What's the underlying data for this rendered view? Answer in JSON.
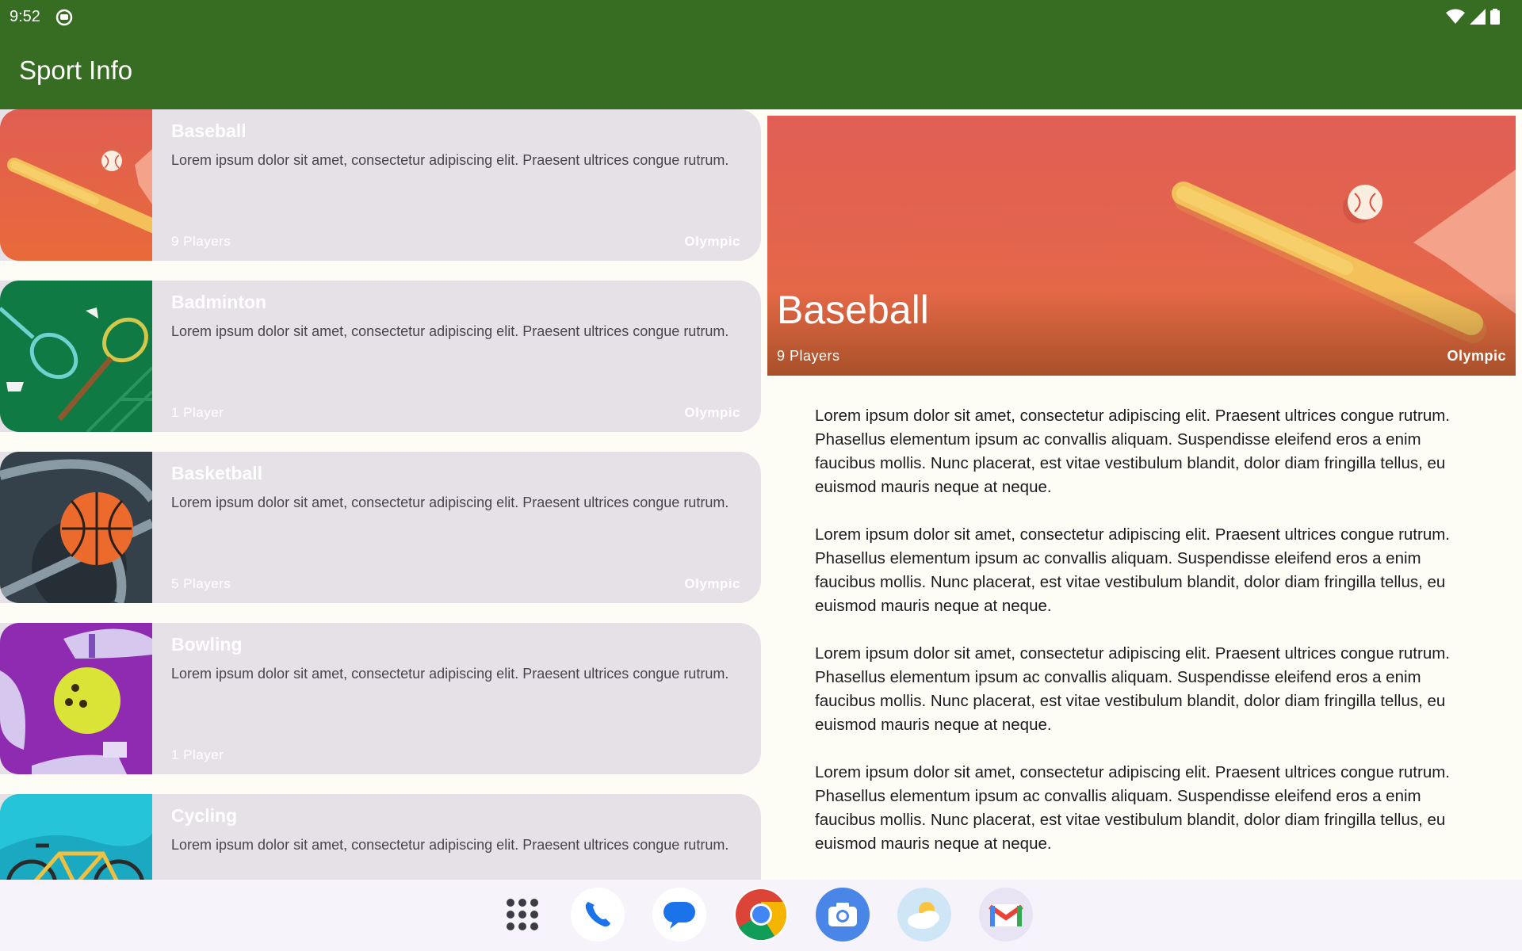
{
  "status": {
    "time": "9:52"
  },
  "app": {
    "title": "Sport Info"
  },
  "sports": [
    {
      "title": "Baseball",
      "description": "Lorem ipsum dolor sit amet, consectetur adipiscing elit. Praesent ultrices congue rutrum.",
      "players": "9 Players",
      "olympic": "Olympic"
    },
    {
      "title": "Badminton",
      "description": "Lorem ipsum dolor sit amet, consectetur adipiscing elit. Praesent ultrices congue rutrum.",
      "players": "1 Player",
      "olympic": "Olympic"
    },
    {
      "title": "Basketball",
      "description": "Lorem ipsum dolor sit amet, consectetur adipiscing elit. Praesent ultrices congue rutrum.",
      "players": "5 Players",
      "olympic": "Olympic"
    },
    {
      "title": "Bowling",
      "description": "Lorem ipsum dolor sit amet, consectetur adipiscing elit. Praesent ultrices congue rutrum.",
      "players": "1 Player",
      "olympic": ""
    },
    {
      "title": "Cycling",
      "description": "Lorem ipsum dolor sit amet, consectetur adipiscing elit. Praesent ultrices congue rutrum.",
      "players": "",
      "olympic": ""
    }
  ],
  "detail": {
    "title": "Baseball",
    "players": "9 Players",
    "olympic": "Olympic",
    "paragraphs": [
      "Lorem ipsum dolor sit amet, consectetur adipiscing elit. Praesent ultrices congue rutrum. Phasellus elementum ipsum ac convallis aliquam. Suspendisse eleifend eros a enim faucibus mollis. Nunc placerat, est vitae vestibulum blandit, dolor diam fringilla tellus, eu euismod mauris neque at neque.",
      " Lorem ipsum dolor sit amet, consectetur adipiscing elit. Praesent ultrices congue rutrum. Phasellus elementum ipsum ac convallis aliquam. Suspendisse eleifend eros a enim faucibus mollis. Nunc placerat, est vitae vestibulum blandit, dolor diam fringilla tellus, eu euismod mauris neque at neque.",
      " Lorem ipsum dolor sit amet, consectetur adipiscing elit. Praesent ultrices congue rutrum. Phasellus elementum ipsum ac convallis aliquam. Suspendisse eleifend eros a enim faucibus mollis. Nunc placerat, est vitae vestibulum blandit, dolor diam fringilla tellus, eu euismod mauris neque at neque.",
      " Lorem ipsum dolor sit amet, consectetur adipiscing elit. Praesent ultrices congue rutrum. Phasellus elementum ipsum ac convallis aliquam. Suspendisse eleifend eros a enim faucibus mollis. Nunc placerat, est vitae vestibulum blandit, dolor diam fringilla tellus, eu euismod mauris neque at neque."
    ]
  },
  "taskbar": [
    "apps-grid-icon",
    "phone-icon",
    "messages-icon",
    "chrome-icon",
    "camera-icon",
    "weather-icon",
    "gmail-icon"
  ],
  "colors": {
    "app_bar": "#366d22",
    "card_bg": "#e6e1e6",
    "background": "#fdfdf6"
  }
}
